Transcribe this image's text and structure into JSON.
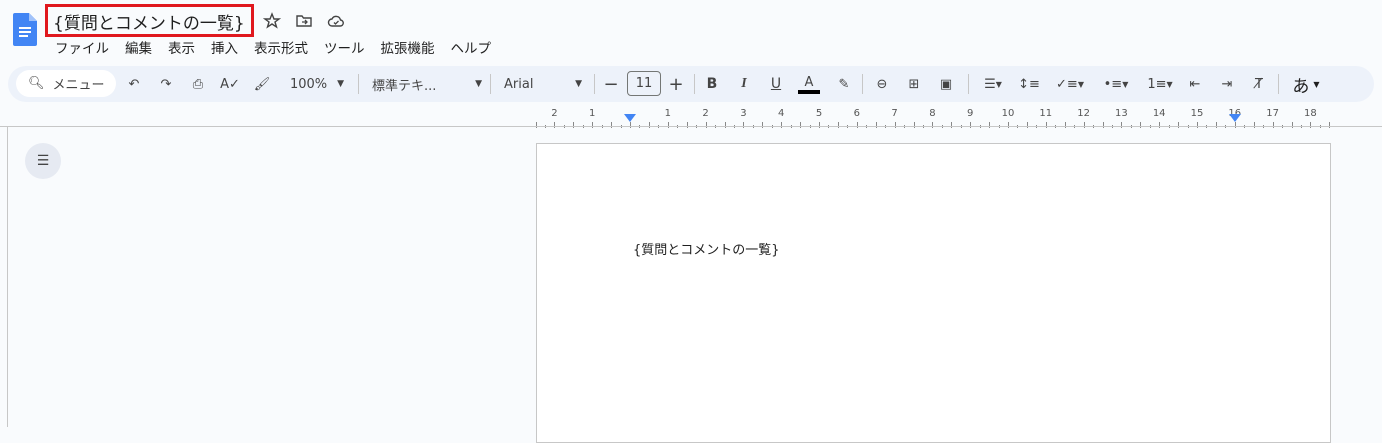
{
  "document": {
    "title": "{質問とコメントの一覧}",
    "body_text": "{質問とコメントの一覧}"
  },
  "menu": [
    "ファイル",
    "編集",
    "表示",
    "挿入",
    "表示形式",
    "ツール",
    "拡張機能",
    "ヘルプ"
  ],
  "toolbar": {
    "search_placeholder": "メニュー",
    "zoom": "100%",
    "style": "標準テキ...",
    "font": "Arial",
    "font_size": "11",
    "input_tools": "あ",
    "text_color": "#000000"
  },
  "ruler": {
    "left_numbers": [
      "2",
      "1"
    ],
    "right_numbers": [
      "1",
      "2",
      "3",
      "4",
      "5",
      "6",
      "7",
      "8",
      "9",
      "10",
      "11",
      "12",
      "13",
      "14",
      "15",
      "16",
      "17",
      "18"
    ]
  },
  "colors": {
    "accent": "#4285f4",
    "highlight_border": "#e0181e"
  }
}
